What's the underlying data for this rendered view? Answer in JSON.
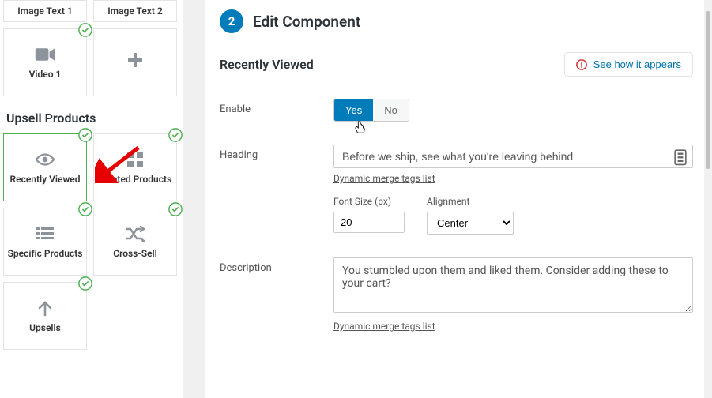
{
  "sidebar": {
    "tiles_top": [
      {
        "label": "Image Text 1",
        "icon": null,
        "checked": false
      },
      {
        "label": "Image Text 2",
        "icon": null,
        "checked": false
      }
    ],
    "tiles_mid": [
      {
        "label": "Video 1",
        "icon": "video-icon",
        "checked": true
      },
      {
        "label": "",
        "icon": "plus-icon",
        "checked": false
      }
    ],
    "heading": "Upsell Products",
    "tiles_upsell": [
      {
        "label": "Recently Viewed",
        "icon": "eye-icon",
        "checked": true,
        "selected": true
      },
      {
        "label": "Related Products",
        "icon": "grid-icon",
        "checked": true,
        "selected": false
      },
      {
        "label": "Specific Products",
        "icon": "list-icon",
        "checked": true,
        "selected": false
      },
      {
        "label": "Cross-Sell",
        "icon": "shuffle-icon",
        "checked": true,
        "selected": false
      },
      {
        "label": "Upsells",
        "icon": "arrow-up-icon",
        "checked": true,
        "selected": false
      }
    ]
  },
  "main": {
    "step_num": "2",
    "step_title": "Edit Component",
    "section_name": "Recently Viewed",
    "see_how_label": "See how it appears",
    "enable": {
      "label": "Enable",
      "yes": "Yes",
      "no": "No",
      "value": "Yes"
    },
    "heading": {
      "label": "Heading",
      "value": "Before we ship, see what you're leaving behind",
      "hint": "Dynamic merge tags list",
      "font_label": "Font Size (px)",
      "font_value": "20",
      "align_label": "Alignment",
      "align_value": "Center"
    },
    "description": {
      "label": "Description",
      "value": "You stumbled upon them and liked them. Consider adding these to your cart?",
      "hint": "Dynamic merge tags list"
    }
  }
}
